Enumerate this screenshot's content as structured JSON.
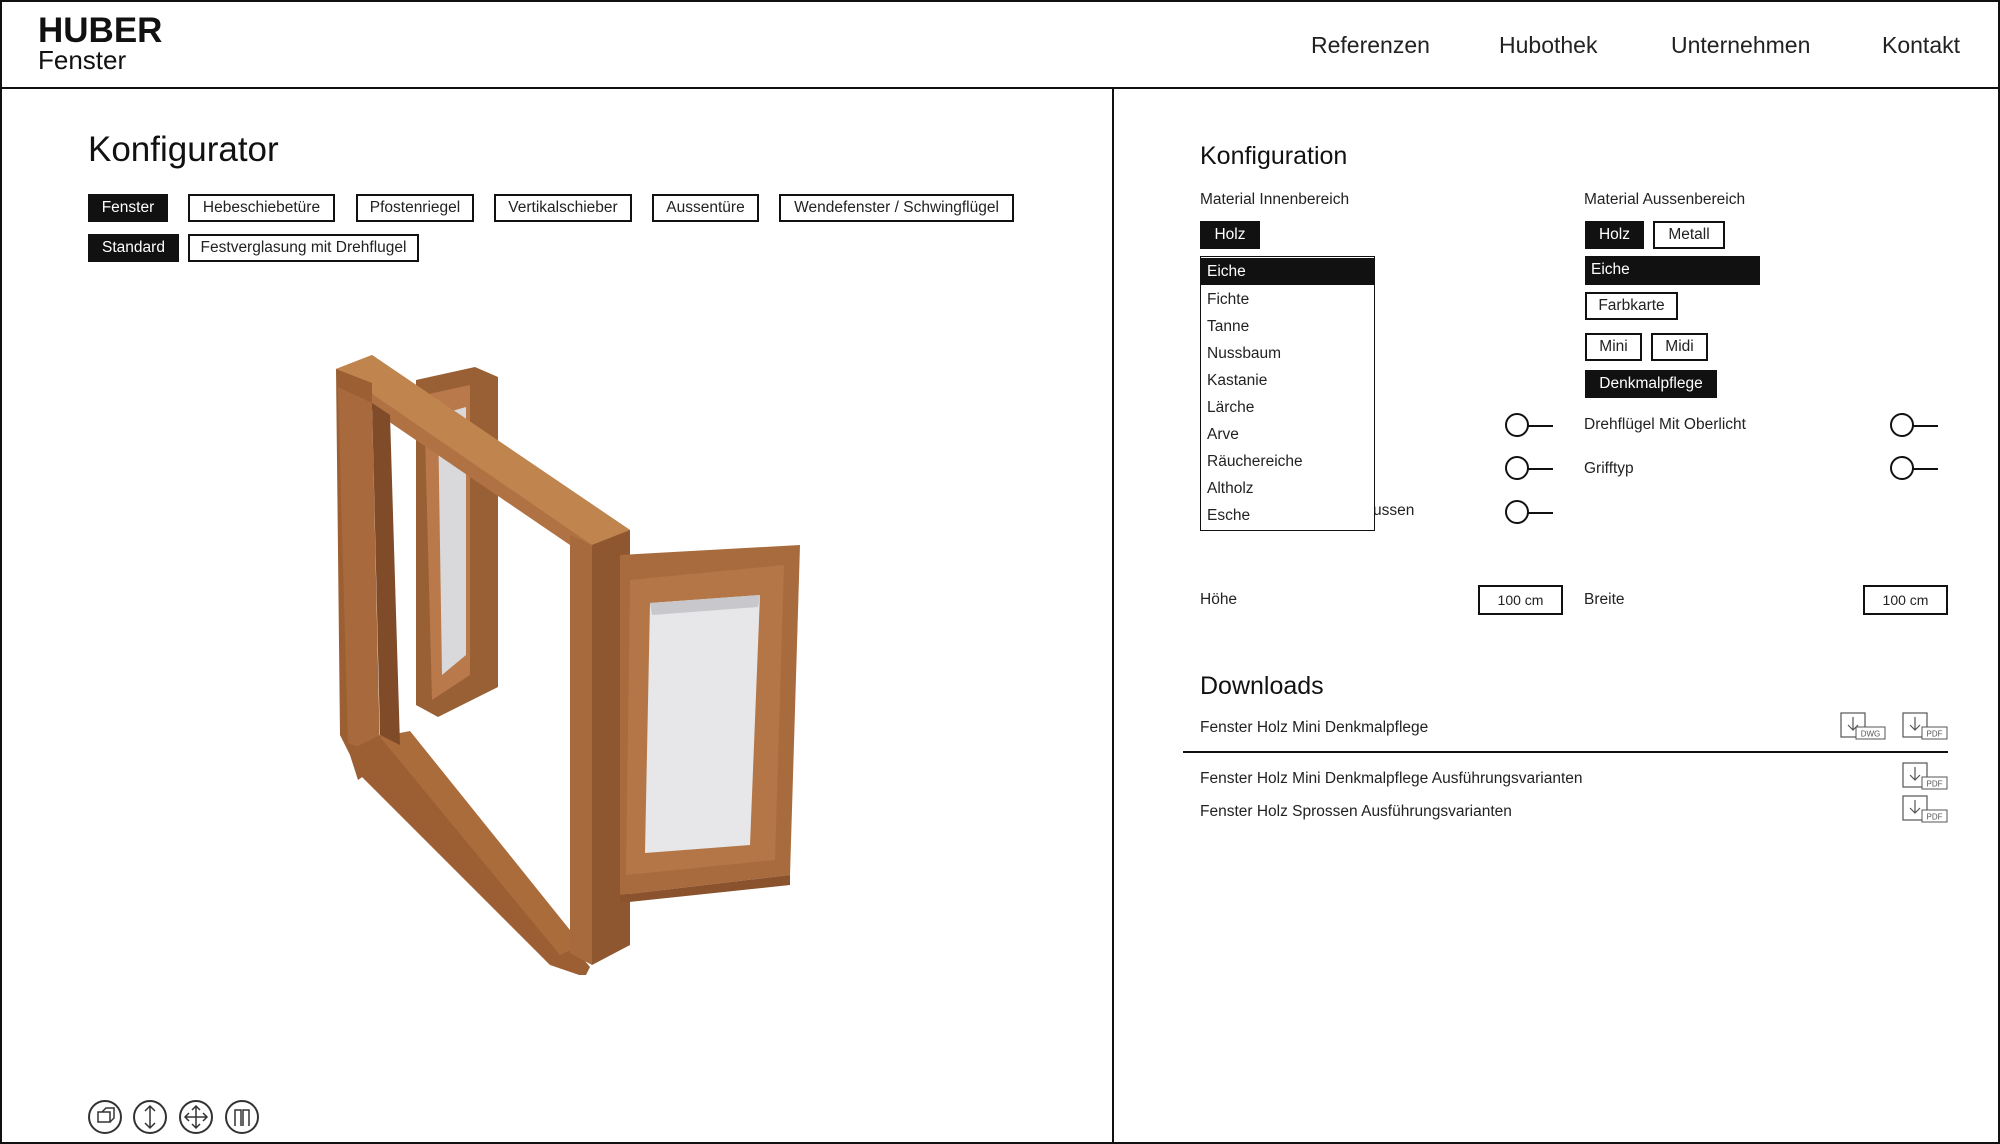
{
  "brand": {
    "line1": "HUBER",
    "line2": "Fenster"
  },
  "nav": [
    "Referenzen",
    "Hubothek",
    "Unternehmen",
    "Kontakt"
  ],
  "left": {
    "title": "Konfigurator",
    "type_tabs": [
      "Fenster",
      "Hebeschiebetüre",
      "Pfostenriegel",
      "Vertikalschieber",
      "Aussentüre",
      "Wendefenster / Schwingflügel"
    ],
    "variant_tabs": [
      "Standard",
      "Festverglasung mit Drehflugel"
    ],
    "active_type": "Fenster",
    "active_variant": "Standard"
  },
  "config": {
    "title": "Konfiguration",
    "material_inside_label": "Material Innenbereich",
    "material_outside_label": "Material Aussenbereich",
    "inside_material": "Holz",
    "outside_materials": [
      "Holz",
      "Metall"
    ],
    "wood_options": [
      "Eiche",
      "Fichte",
      "Tanne",
      "Nussbaum",
      "Kastanie",
      "Lärche",
      "Arve",
      "Räuchereiche",
      "Altholz",
      "Esche"
    ],
    "selected_wood_inside": "Eiche",
    "selected_wood_outside": "Eiche",
    "farbkarte": "Farbkarte",
    "profile_options": [
      "Mini",
      "Midi"
    ],
    "denkmalpflege": "Denkmalpflege",
    "hidden_toggle_label_suffix": "ussen",
    "toggle_drehfluegel": "Drehflügel Mit Oberlicht",
    "toggle_grifftyp": "Grifftyp",
    "height_label": "Höhe",
    "height_value": "100 cm",
    "width_label": "Breite",
    "width_value": "100 cm"
  },
  "downloads": {
    "title": "Downloads",
    "items": [
      {
        "label": "Fenster Holz Mini Denkmalpflege",
        "files": [
          "DWG",
          "PDF"
        ]
      },
      {
        "label": "Fenster Holz Mini Denkmalpflege Ausführungsvarianten",
        "files": [
          "PDF"
        ]
      },
      {
        "label": "Fenster Holz Sprossen Ausführungsvarianten",
        "files": [
          "PDF"
        ]
      }
    ]
  },
  "icons": [
    "rotate-view-icon",
    "move-vertical-icon",
    "move-all-icon",
    "open-sash-icon"
  ],
  "colors": {
    "accent": "#111111",
    "wood": "#a86c3e",
    "glass": "#e6e6e8"
  }
}
